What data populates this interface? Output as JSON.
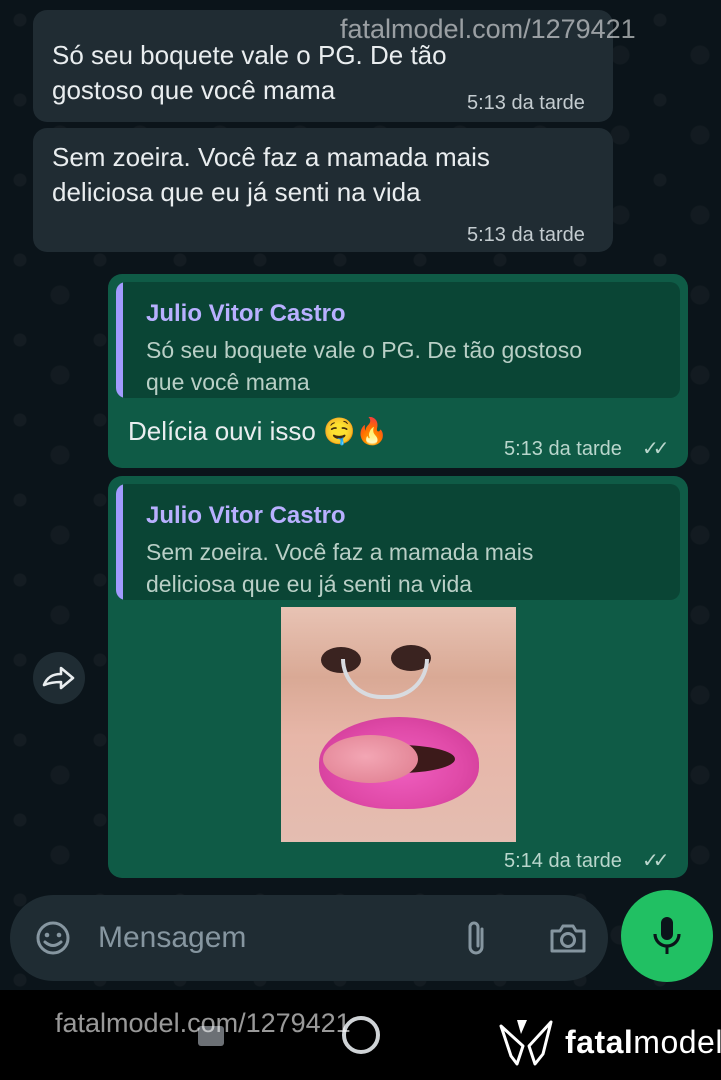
{
  "watermark": {
    "top": "fatalmodel.com/1279421",
    "bottom": "fatalmodel.com/1279421"
  },
  "messages": [
    {
      "id": "msg1",
      "direction": "incoming",
      "lines": [
        "Só seu boquete vale o PG.  De tão",
        "gostoso que você mama"
      ],
      "time": "5:13 da tarde"
    },
    {
      "id": "msg2",
      "direction": "incoming",
      "lines": [
        "Sem zoeira. Você faz a mamada mais",
        "deliciosa que eu já senti na vida"
      ],
      "time": "5:13 da tarde"
    },
    {
      "id": "msg3",
      "direction": "outgoing",
      "quote": {
        "author": "Julio Vitor Castro",
        "lines": [
          "Só seu boquete vale o PG.  De tão gostoso",
          "que você mama"
        ]
      },
      "text": "Delícia ouvi isso 🤤🔥",
      "time": "5:13 da tarde",
      "status": "read-ticks"
    },
    {
      "id": "msg4",
      "direction": "outgoing",
      "quote": {
        "author": "Julio Vitor Castro",
        "lines": [
          "Sem zoeira. Você faz a mamada mais",
          "deliciosa que eu já senti na vida"
        ]
      },
      "media": "photo",
      "time": "5:14 da tarde",
      "status": "read-ticks"
    }
  ],
  "composer": {
    "placeholder": "Mensagem",
    "icons": [
      "sticker-icon",
      "attach-icon",
      "camera-icon",
      "mic-icon"
    ]
  },
  "brand": {
    "name_bold": "fatal",
    "name_rest": "model"
  },
  "colors": {
    "incoming_bubble": "#202c33",
    "outgoing_bubble": "#0f5b46",
    "mic_button": "#21c063",
    "quote_author": "#b8b0ff"
  }
}
